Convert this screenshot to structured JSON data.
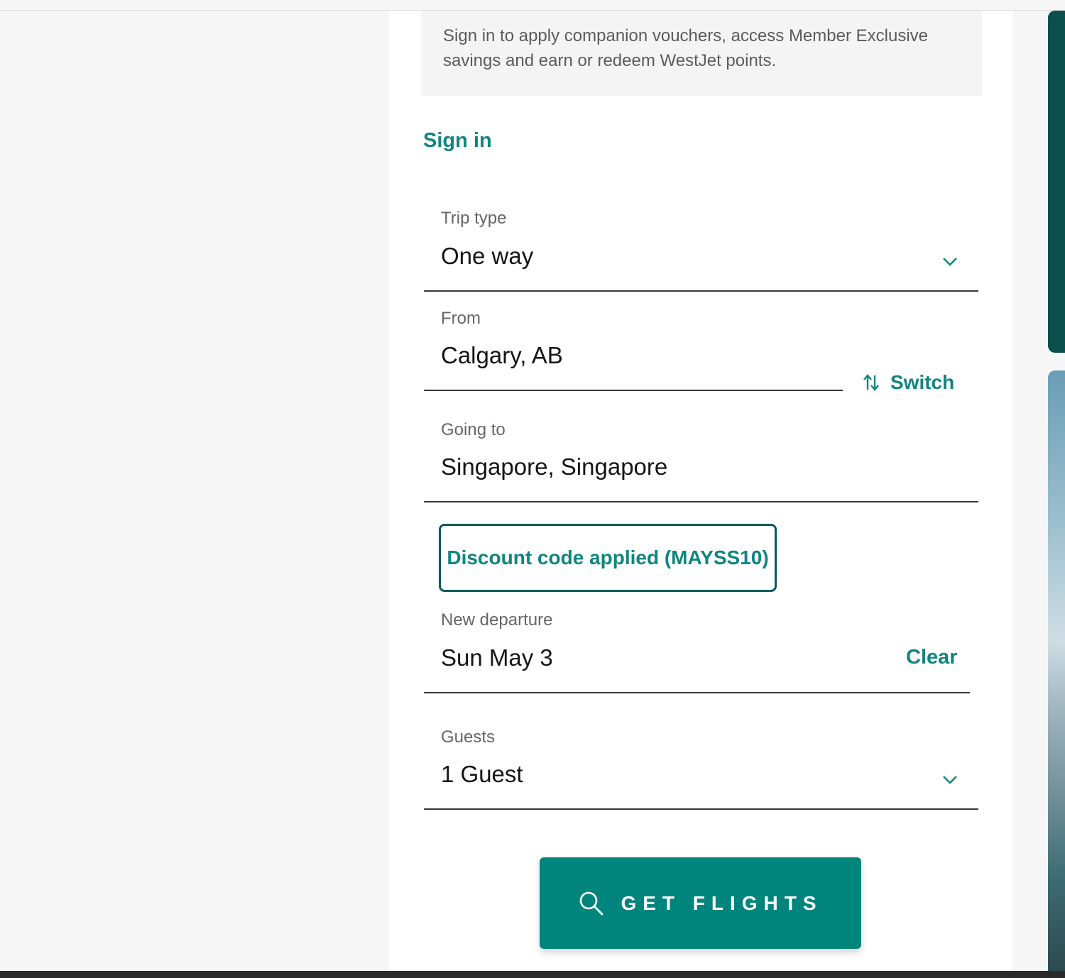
{
  "notice": {
    "text": "Sign in to apply companion vouchers, access Member Exclusive savings and earn or redeem WestJet points."
  },
  "signin": {
    "label": "Sign in"
  },
  "trip_type": {
    "label": "Trip type",
    "value": "One way"
  },
  "from": {
    "label": "From",
    "value": "Calgary, AB"
  },
  "switch": {
    "label": "Switch"
  },
  "going_to": {
    "label": "Going to",
    "value": "Singapore, Singapore"
  },
  "discount": {
    "label": "Discount code applied (MAYSS10)"
  },
  "departure": {
    "label": "New departure",
    "value": "Sun May 3",
    "clear_label": "Clear"
  },
  "guests": {
    "label": "Guests",
    "value": "1 Guest"
  },
  "search_button": {
    "label": "GET FLIGHTS",
    "icon": "search-icon"
  },
  "colors": {
    "accent": "#0f8580",
    "button": "#00857d",
    "dark_teal": "#0b4f4d"
  }
}
